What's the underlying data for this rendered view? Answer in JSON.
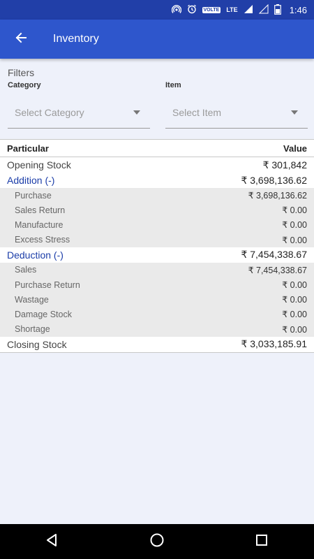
{
  "status_bar": {
    "volte": "VOLTE",
    "lte": "LTE",
    "time": "1:46"
  },
  "app_bar": {
    "title": "Inventory"
  },
  "filters": {
    "title": "Filters",
    "category": {
      "label": "Category",
      "placeholder": "Select Category"
    },
    "item": {
      "label": "Item",
      "placeholder": "Select Item"
    }
  },
  "table": {
    "headers": {
      "particular": "Particular",
      "value": "Value"
    },
    "opening": {
      "label": "Opening Stock",
      "value": "₹ 301,842"
    },
    "addition": {
      "label": "Addition (-)",
      "value": "₹ 3,698,136.62",
      "items": [
        {
          "label": "Purchase",
          "value": "₹ 3,698,136.62"
        },
        {
          "label": "Sales Return",
          "value": "₹ 0.00"
        },
        {
          "label": "Manufacture",
          "value": "₹ 0.00"
        },
        {
          "label": "Excess Stress",
          "value": "₹ 0.00"
        }
      ]
    },
    "deduction": {
      "label": "Deduction (-)",
      "value": "₹ 7,454,338.67",
      "items": [
        {
          "label": "Sales",
          "value": "₹ 7,454,338.67"
        },
        {
          "label": "Purchase Return",
          "value": "₹ 0.00"
        },
        {
          "label": "Wastage",
          "value": "₹ 0.00"
        },
        {
          "label": "Damage Stock",
          "value": "₹ 0.00"
        },
        {
          "label": "Shortage",
          "value": "₹ 0.00"
        }
      ]
    },
    "closing": {
      "label": "Closing Stock",
      "value": "₹ 3,033,185.91"
    }
  },
  "colors": {
    "status_bar": "#213fa8",
    "app_bar": "#2e56cc",
    "accent_text": "#1a3ca8",
    "background": "#eef1fa"
  },
  "icons": {
    "status": [
      "hotspot-icon",
      "alarm-icon",
      "signal-icon",
      "battery-icon"
    ],
    "app_bar": "back-arrow-icon",
    "nav": [
      "back-triangle-icon",
      "home-circle-icon",
      "recents-square-icon"
    ]
  }
}
